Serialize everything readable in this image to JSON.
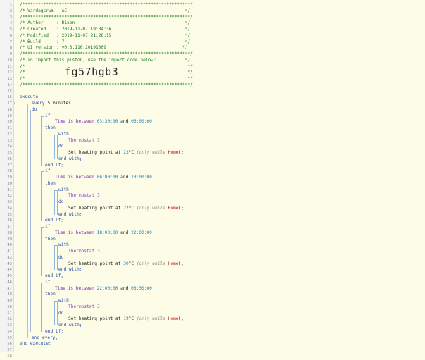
{
  "editor": {
    "line_count": 58,
    "import_code": "fg57hgb3"
  },
  "header": {
    "border": "/****************************************************************/",
    "title": "/* Vardagsrum - AC                                             */",
    "author": "/* Author     : Dixon                                          */",
    "created": "/* Created    : 2019-11-07 19:34:36                            */",
    "modified": "/* Modified   : 2019-11-07 21:28:15                            */",
    "build": "/* Build      : 7                                              */",
    "ui_version": "/* UI version : v0.3.110.20191009                             */",
    "import_note": "/* To import this piston, use the import code below:           */",
    "blank": "/*                                                              */"
  },
  "code": {
    "execute": "execute",
    "every": "every",
    "every_value": "5 minutes",
    "do": "do",
    "if": "if",
    "then": "then",
    "with": "with",
    "end_with": "end with;",
    "end_if": "end if;",
    "end_every": "end every;",
    "end_execute": "end execute;",
    "time_is_between": "Time is between",
    "and": "and",
    "device": "Thermostat 3",
    "set_heating": "Set heating point at",
    "unit": "°C",
    "only_while": "(only while",
    "location_mode": "Home",
    "close_paren": ");"
  },
  "blocks": [
    {
      "from": "03:30:00",
      "to": "06:00:00",
      "setpoint": "23"
    },
    {
      "from": "06:00:00",
      "to": "18:00:00",
      "setpoint": "22"
    },
    {
      "from": "18:00:00",
      "to": "22:00:00",
      "setpoint": "30"
    },
    {
      "from": "22:00:00",
      "to": "03:30:00",
      "setpoint": "19"
    }
  ],
  "colors": {
    "background": "#fdfde7",
    "comment": "#1f7a1f",
    "keyword": "#2a4fa8",
    "condition": "#7c2fb8",
    "device": "#8e3fd1",
    "number": "#1a7fbf",
    "location": "#c01515"
  }
}
